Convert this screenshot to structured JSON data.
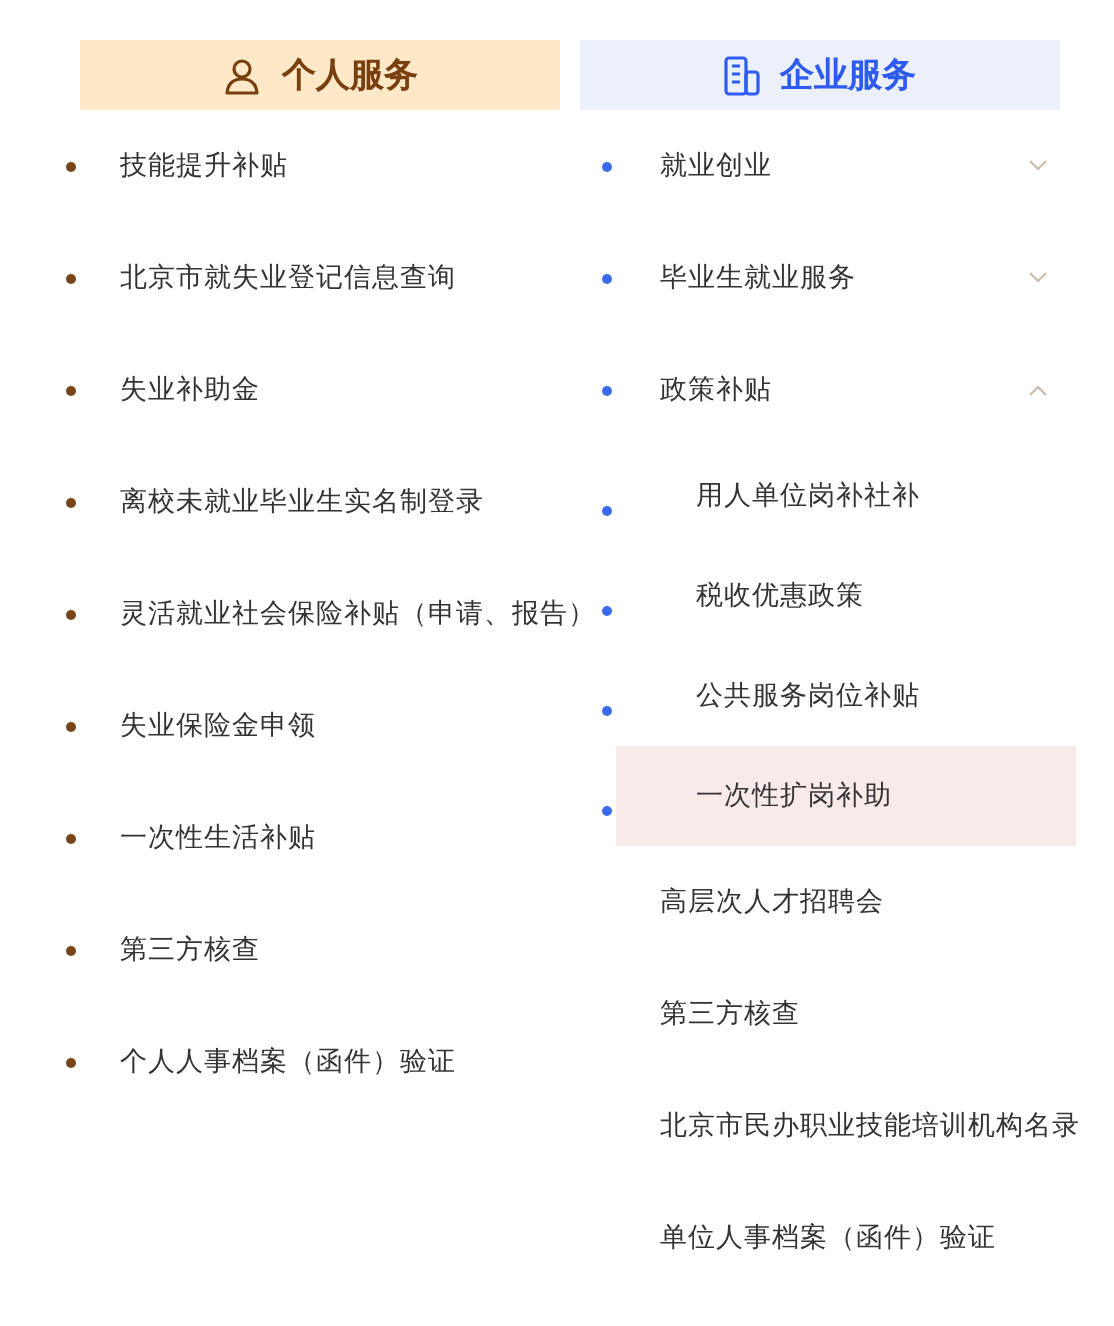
{
  "personal": {
    "title": "个人服务",
    "items": [
      {
        "label": "技能提升补贴"
      },
      {
        "label": "北京市就失业登记信息查询"
      },
      {
        "label": "失业补助金"
      },
      {
        "label": "离校未就业毕业生实名制登录"
      },
      {
        "label": "灵活就业社会保险补贴（申请、报告）"
      },
      {
        "label": "失业保险金申领"
      },
      {
        "label": "一次性生活补贴"
      },
      {
        "label": "第三方核查"
      },
      {
        "label": "个人人事档案（函件）验证"
      }
    ]
  },
  "enterprise": {
    "title": "企业服务",
    "items": [
      {
        "kind": "group",
        "label": "就业创业",
        "expanded": false
      },
      {
        "kind": "group",
        "label": "毕业生就业服务",
        "expanded": false
      },
      {
        "kind": "group",
        "label": "政策补贴",
        "expanded": true,
        "children": [
          {
            "label": "用人单位岗补社补",
            "selected": false
          },
          {
            "label": "税收优惠政策",
            "selected": false
          },
          {
            "label": "公共服务岗位补贴",
            "selected": false
          },
          {
            "label": "一次性扩岗补助",
            "selected": true
          }
        ]
      },
      {
        "kind": "link",
        "label": "高层次人才招聘会"
      },
      {
        "kind": "link",
        "label": "第三方核查"
      },
      {
        "kind": "link",
        "label": "北京市民办职业技能培训机构名录"
      },
      {
        "kind": "link",
        "label": "单位人事档案（函件）验证"
      }
    ]
  }
}
